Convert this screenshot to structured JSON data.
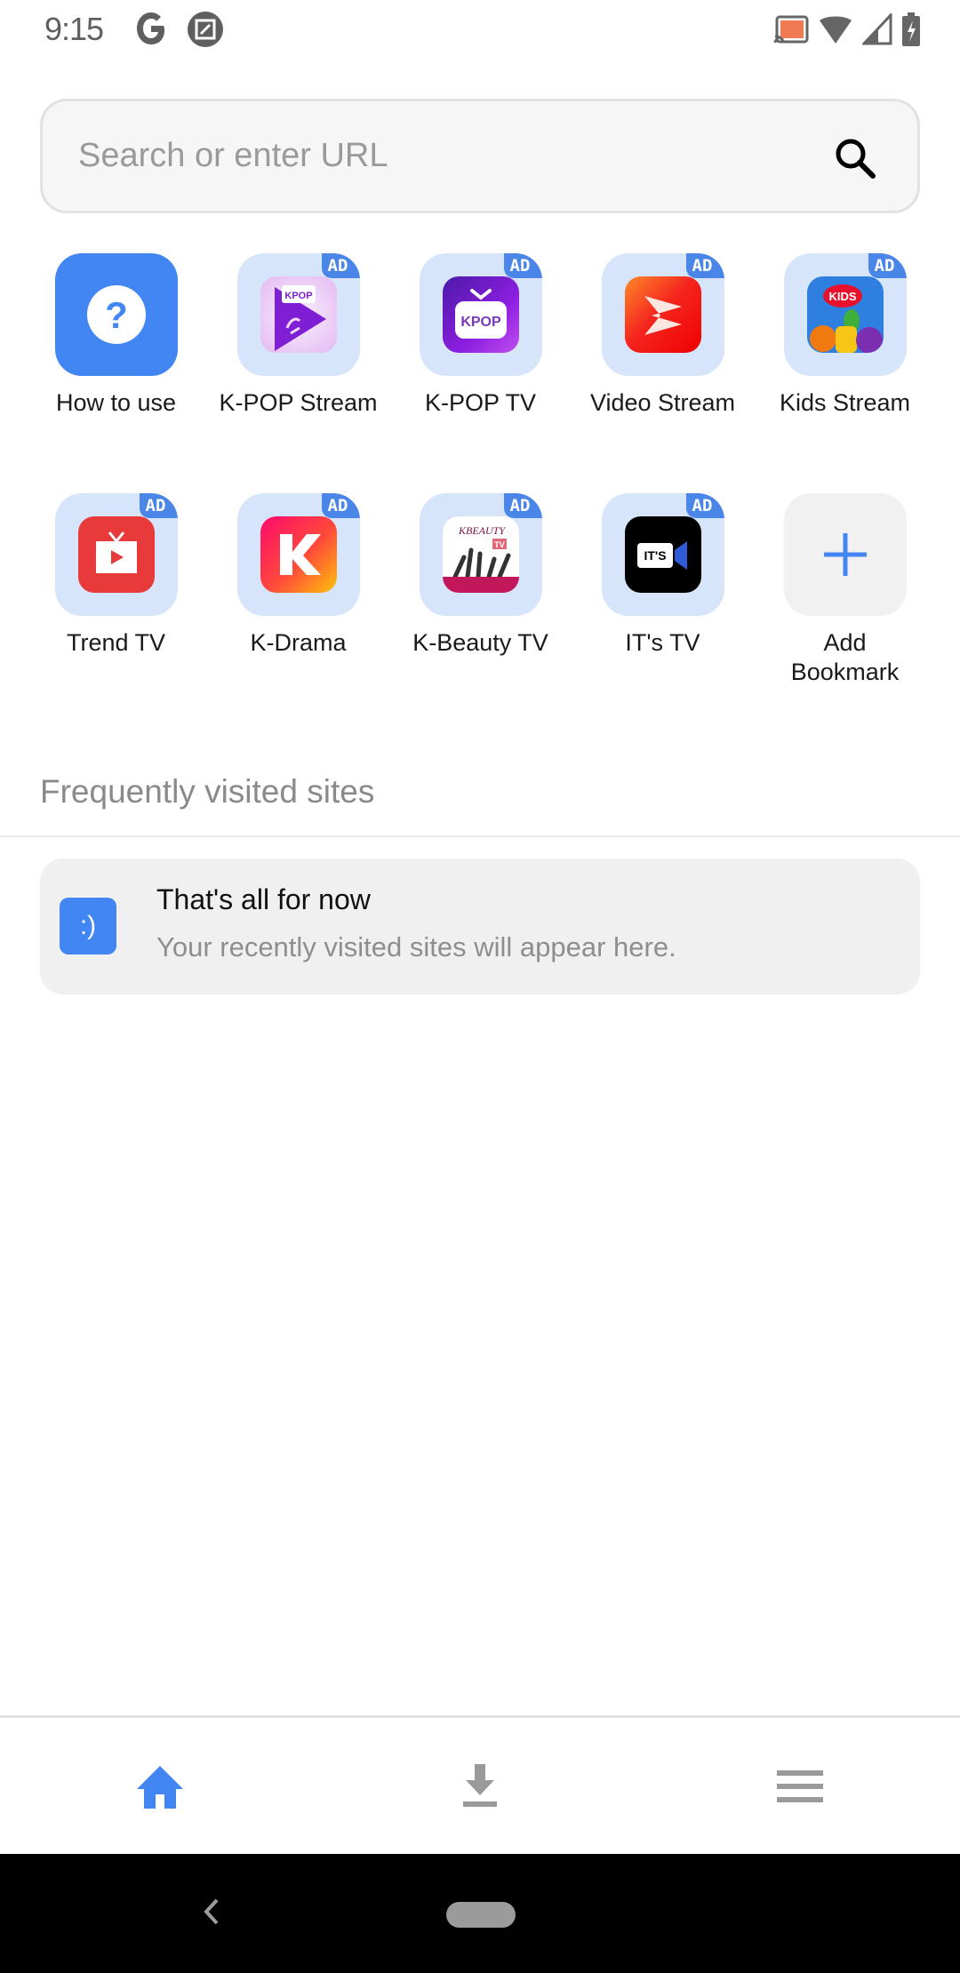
{
  "status_bar": {
    "time": "9:15",
    "left_icons": [
      "google-g-icon",
      "screenshot-edit-icon"
    ],
    "right_icons": [
      "cast-icon",
      "wifi-icon",
      "cell-signal-icon",
      "battery-charging-icon"
    ],
    "cast_color": "#f07a52"
  },
  "search": {
    "placeholder": "Search or enter URL",
    "value": "",
    "icon": "search-icon"
  },
  "shortcuts": [
    {
      "label": "How to use",
      "icon": "help-icon",
      "ad": false
    },
    {
      "label": "K-POP Stream",
      "icon": "kpop-stream-app-icon",
      "ad": true,
      "ad_label": "AD"
    },
    {
      "label": "K-POP TV",
      "icon": "kpop-tv-app-icon",
      "ad": true,
      "ad_label": "AD"
    },
    {
      "label": "Video Stream",
      "icon": "video-stream-app-icon",
      "ad": true,
      "ad_label": "AD"
    },
    {
      "label": "Kids Stream",
      "icon": "kids-stream-app-icon",
      "ad": true,
      "ad_label": "AD"
    },
    {
      "label": "Trend TV",
      "icon": "trend-tv-app-icon",
      "ad": true,
      "ad_label": "AD"
    },
    {
      "label": "K-Drama",
      "icon": "k-drama-app-icon",
      "ad": true,
      "ad_label": "AD"
    },
    {
      "label": "K-Beauty TV",
      "icon": "k-beauty-tv-app-icon",
      "ad": true,
      "ad_label": "AD"
    },
    {
      "label": "IT's TV",
      "icon": "its-tv-app-icon",
      "ad": true,
      "ad_label": "AD"
    },
    {
      "label": "Add Bookmark",
      "icon": "plus-icon",
      "ad": false
    }
  ],
  "icon_texts": {
    "kpop_stream": "KPOP",
    "kpop_tv": "KPOP",
    "kids": "KIDS",
    "kbeauty": "KBEAUTY",
    "kbeauty_tv": "TV",
    "its": "IT'S",
    "kdrama": "K"
  },
  "frequent": {
    "title": "Frequently visited sites",
    "empty_icon_text": ":)",
    "empty_title": "That's all for now",
    "empty_subtitle": "Your recently visited sites will appear here."
  },
  "bottom_nav": {
    "items": [
      {
        "name": "home",
        "icon": "home-icon",
        "active": true
      },
      {
        "name": "downloads",
        "icon": "download-icon",
        "active": false
      },
      {
        "name": "menu",
        "icon": "menu-icon",
        "active": false
      }
    ],
    "active_color": "#4286f4",
    "inactive_color": "#9a9a9a"
  },
  "colors": {
    "accent": "#4286f4",
    "tile_bg": "#d6e5fa",
    "ad_badge": "#4a86e8"
  }
}
